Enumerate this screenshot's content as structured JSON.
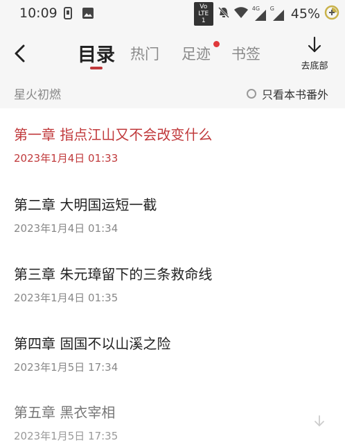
{
  "status_bar": {
    "time": "10:09",
    "network_badge": "Vo LTE 1",
    "signal_4g": "4G",
    "signal_g": "G",
    "battery": "45%"
  },
  "nav": {
    "tabs": [
      {
        "label": "目录",
        "active": true
      },
      {
        "label": "热门",
        "active": false
      },
      {
        "label": "足迹",
        "active": false,
        "badge": true
      },
      {
        "label": "书签",
        "active": false
      }
    ],
    "to_bottom_label": "去底部",
    "accent_color": "#c0393b"
  },
  "sub_header": {
    "book_title": "星火初燃",
    "filter_label": "只看本书番外"
  },
  "chapters": [
    {
      "title": "第一章 指点江山又不会改变什么",
      "date": "2023年1月4日 01:33"
    },
    {
      "title": "第二章 大明国运短一截",
      "date": "2023年1月4日 01:34"
    },
    {
      "title": "第三章 朱元璋留下的三条救命线",
      "date": "2023年1月4日 01:35"
    },
    {
      "title": "第四章 固国不以山溪之险",
      "date": "2023年1月5日 17:34"
    },
    {
      "title": "第五章 黑衣宰相",
      "date": "2023年1月5日 17:35"
    }
  ]
}
